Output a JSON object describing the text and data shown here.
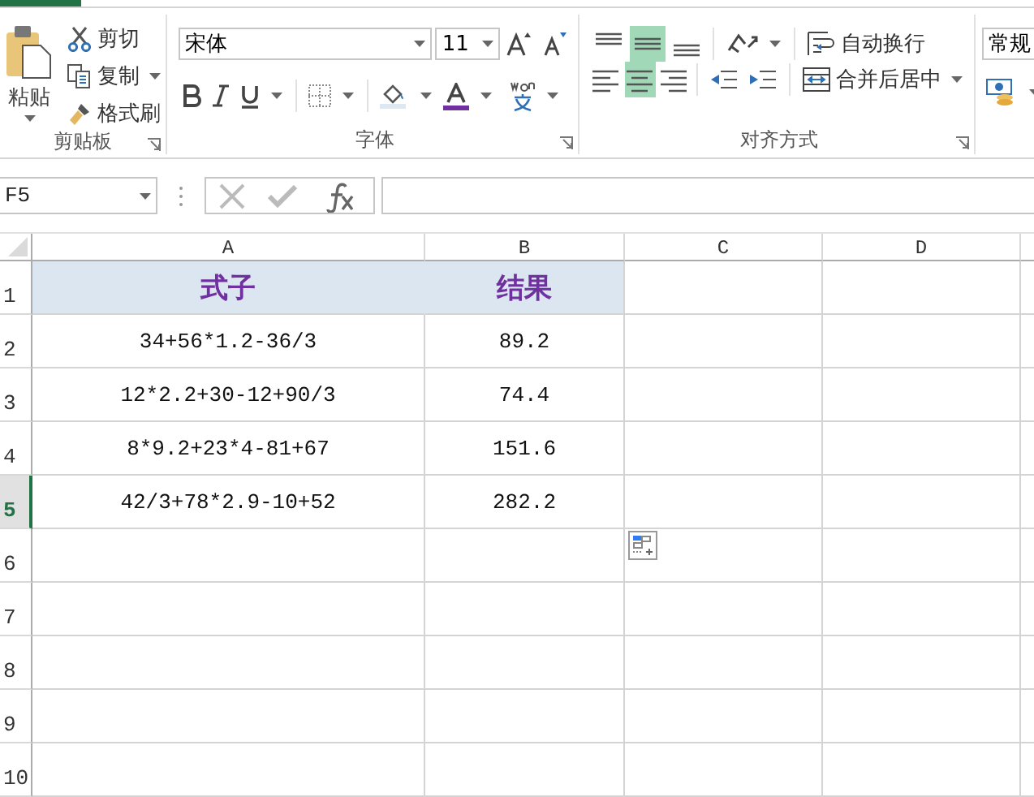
{
  "ribbon": {
    "clipboard": {
      "paste": "粘贴",
      "items": [
        {
          "kind": "cut",
          "label": "剪切"
        },
        {
          "kind": "copy",
          "label": "复制"
        },
        {
          "kind": "format",
          "label": "格式刷"
        }
      ],
      "label": "剪贴板"
    },
    "font": {
      "font_name": "宋体",
      "font_size": "11",
      "label": "字体"
    },
    "alignment": {
      "vertical": [
        {
          "selected": false
        },
        {
          "selected": true
        },
        {
          "selected": false
        }
      ],
      "horizontal": [
        {
          "selected": false
        },
        {
          "selected": true
        },
        {
          "selected": false
        }
      ],
      "wrap_text": "自动换行",
      "merge_center": "合并后居中",
      "label": "对齐方式"
    },
    "number": {
      "format": "常规"
    }
  },
  "formula_bar": {
    "name_box": "F5"
  },
  "sheet": {
    "columns": [
      "A",
      "B",
      "C",
      "D"
    ],
    "rows": [
      {
        "number": "1",
        "kind": "header",
        "selected": false,
        "cells": [
          "式子",
          "结果"
        ]
      },
      {
        "number": "2",
        "kind": "data",
        "selected": false,
        "cells": [
          "34+56*1.2-36/3",
          "89.2"
        ]
      },
      {
        "number": "3",
        "kind": "data",
        "selected": false,
        "cells": [
          "12*2.2+30-12+90/3",
          "74.4"
        ]
      },
      {
        "number": "4",
        "kind": "data",
        "selected": false,
        "cells": [
          "8*9.2+23*4-81+67",
          "151.6"
        ]
      },
      {
        "number": "5",
        "kind": "data",
        "selected": true,
        "cells": [
          "42/3+78*2.9-10+52",
          "282.2"
        ]
      },
      {
        "number": "6",
        "kind": "empty",
        "selected": false
      },
      {
        "number": "7",
        "kind": "empty",
        "selected": false
      },
      {
        "number": "8",
        "kind": "empty",
        "selected": false
      },
      {
        "number": "9",
        "kind": "empty",
        "selected": false
      },
      {
        "number": "10",
        "kind": "empty",
        "selected": false
      }
    ]
  }
}
